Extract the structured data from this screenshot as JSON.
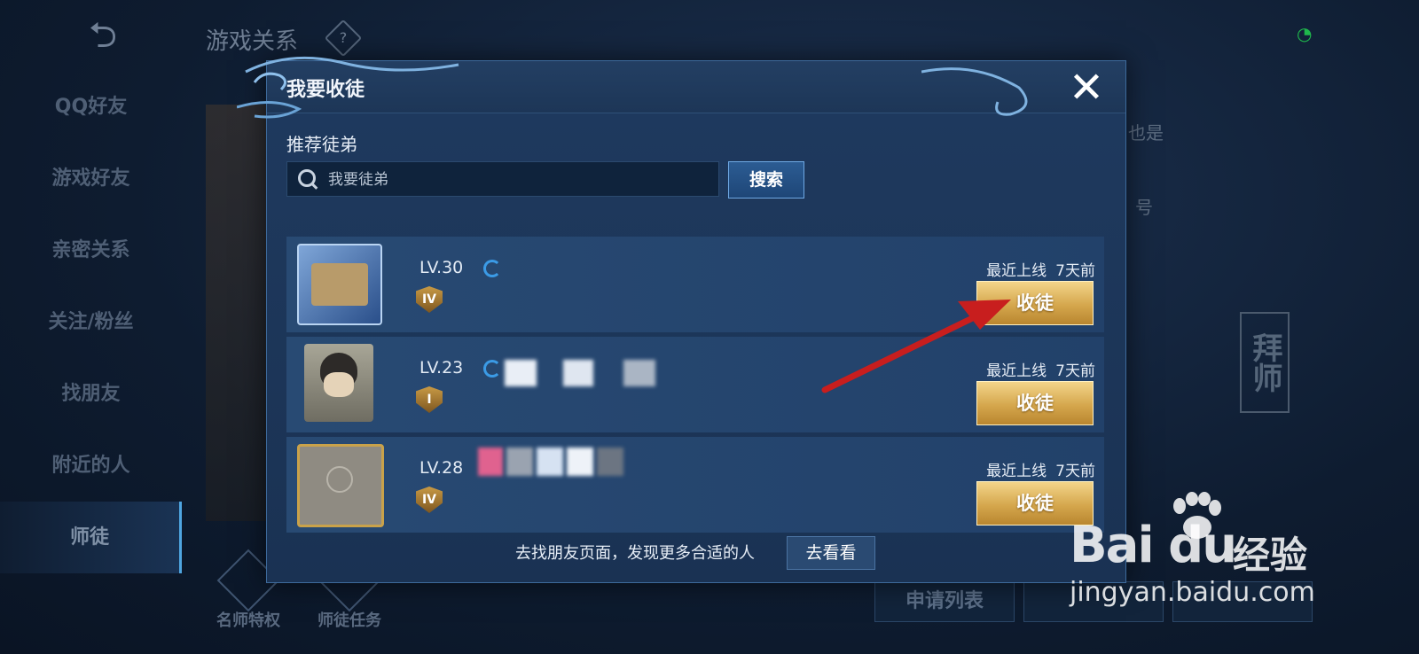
{
  "background": {
    "page_title": "游戏关系",
    "help_glyph": "?",
    "sidebar": [
      {
        "label": "QQ好友"
      },
      {
        "label": "游戏好友"
      },
      {
        "label": "亲密关系"
      },
      {
        "label": "关注/粉丝"
      },
      {
        "label": "找朋友"
      },
      {
        "label": "附近的人"
      },
      {
        "label": "师徒"
      }
    ],
    "bottom_icons": [
      {
        "label": "名师特权"
      },
      {
        "label": "师徒任务"
      }
    ],
    "right_text_1": "也是",
    "right_text_2": "号",
    "seal_text": "拜师",
    "bottom_buttons": [
      {
        "label": "申请列表"
      },
      {
        "label": ""
      },
      {
        "label": ""
      }
    ]
  },
  "dialog": {
    "title": "我要收徒",
    "close_glyph": "✕",
    "section_title": "推荐徒弟",
    "search_placeholder": "我要徒弟",
    "search_button": "搜索",
    "candidates": [
      {
        "level": "LV.30",
        "rank_badge": "IV",
        "online_label": "最近上线",
        "online_time": "7天前",
        "action": "收徒"
      },
      {
        "level": "LV.23",
        "rank_badge": "I",
        "online_label": "最近上线",
        "online_time": "7天前",
        "action": "收徒"
      },
      {
        "level": "LV.28",
        "rank_badge": "IV",
        "online_label": "最近上线",
        "online_time": "7天前",
        "action": "收徒"
      }
    ],
    "footer_text": "去找朋友页面，发现更多合适的人",
    "footer_button": "去看看"
  },
  "watermark": {
    "logo_text": "Bai du",
    "cn_text": "经验",
    "url": "jingyan.baidu.com"
  },
  "colors": {
    "gold_button": "#d5a74d",
    "dialog_bg": "#1f3a5f",
    "annotation_arrow": "#c81e1e"
  }
}
